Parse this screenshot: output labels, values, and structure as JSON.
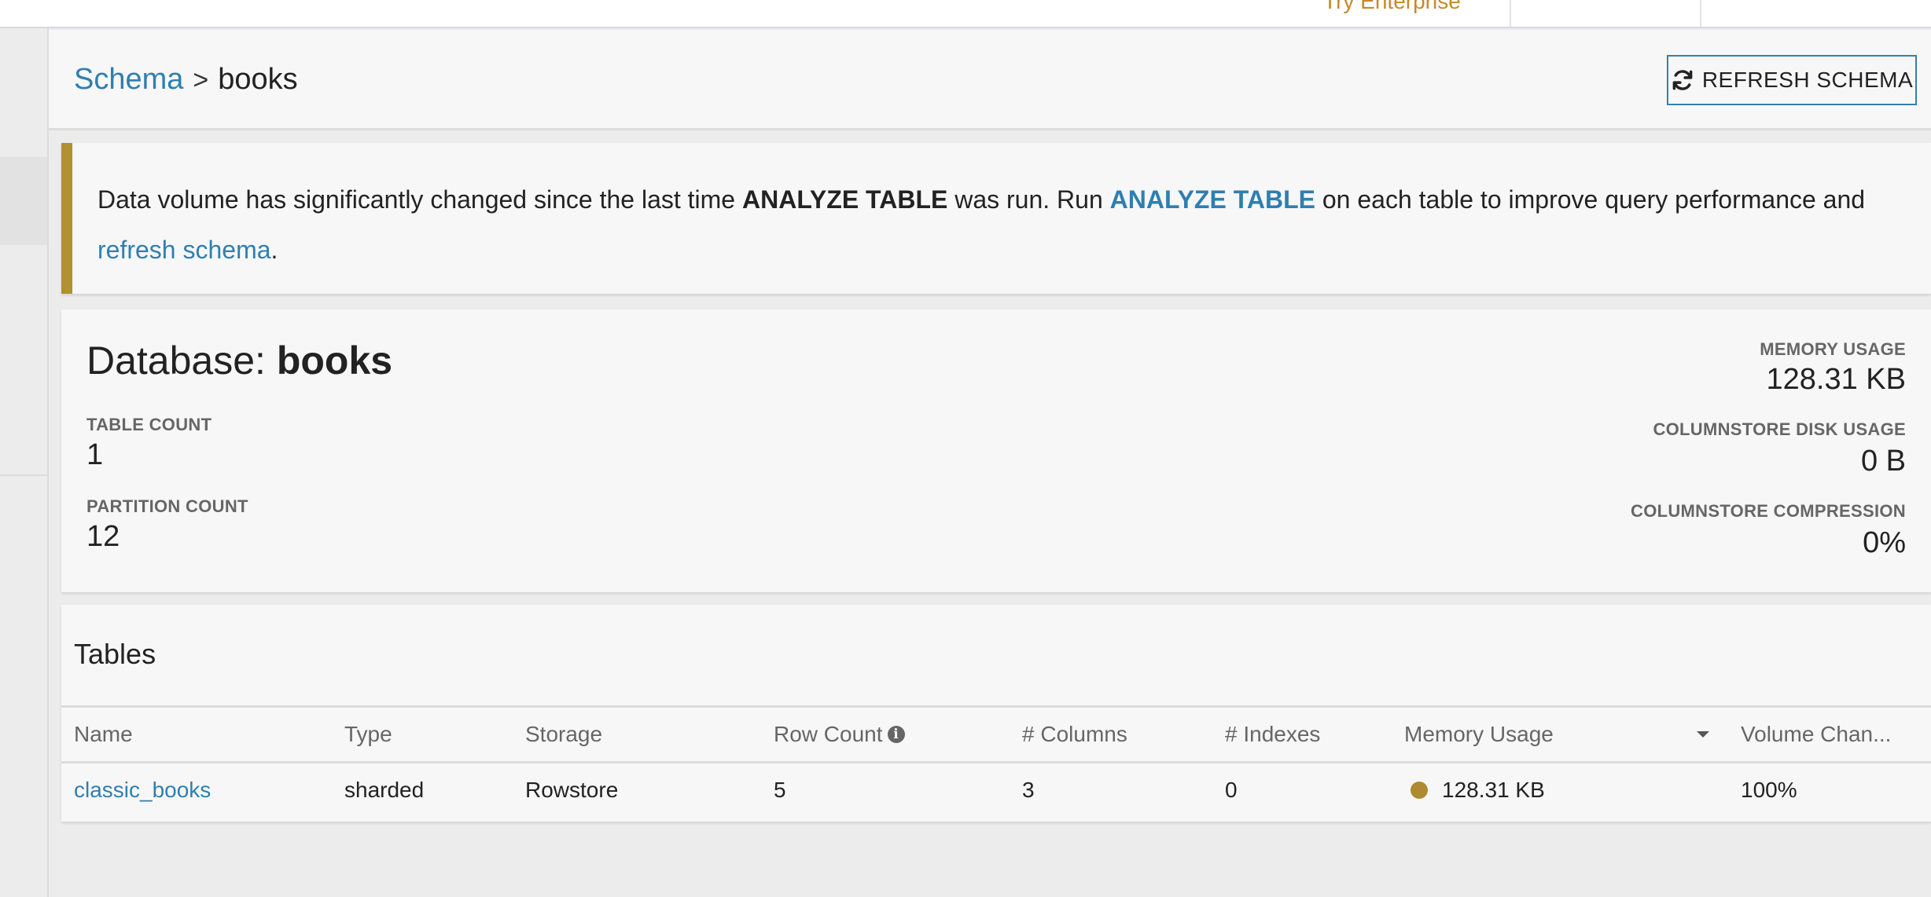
{
  "topbar": {
    "try_enterprise": "Try Enterprise"
  },
  "breadcrumb": {
    "root": "Schema",
    "separator": ">",
    "current": "books"
  },
  "toolbar": {
    "refresh_label": "REFRESH SCHEMA",
    "refresh_icon": "refresh-icon"
  },
  "banner": {
    "text_1": "Data volume has significantly changed since the last time ",
    "keyword": "ANALYZE TABLE",
    "text_2": " was run. Run ",
    "action_link": "ANALYZE TABLE",
    "text_3": " on each table to improve query performance and ",
    "refresh_link": "refresh schema",
    "text_4": ".",
    "accent_color": "#b09030"
  },
  "database": {
    "title_prefix": "Database: ",
    "name": "books",
    "table_count_label": "TABLE COUNT",
    "table_count": "1",
    "partition_count_label": "PARTITION COUNT",
    "partition_count": "12",
    "memory_usage_label": "MEMORY USAGE",
    "memory_usage": "128.31 KB",
    "disk_usage_label": "COLUMNSTORE DISK USAGE",
    "disk_usage": "0 B",
    "compression_label": "COLUMNSTORE COMPRESSION",
    "compression": "0%"
  },
  "tables": {
    "title": "Tables",
    "columns": [
      "Name",
      "Type",
      "Storage",
      "Row Count",
      "# Columns",
      "# Indexes",
      "Memory Usage",
      "Volume Chan..."
    ],
    "rows": [
      {
        "name": "classic_books",
        "type": "sharded",
        "storage": "Rowstore",
        "row_count": "5",
        "columns": "3",
        "indexes": "0",
        "memory_usage": "128.31 KB",
        "memory_color": "#b08a30",
        "volume_change": "100%"
      }
    ]
  },
  "colors": {
    "link": "#2f7fb0",
    "accent": "#b09030",
    "enterprise": "#c6892c"
  }
}
